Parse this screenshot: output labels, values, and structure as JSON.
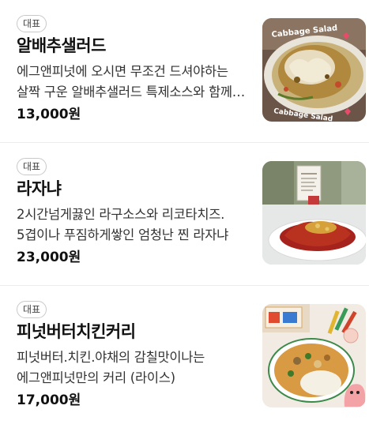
{
  "menu": {
    "items": [
      {
        "badge": "대표",
        "name": "알배추샐러드",
        "description": "에그앤피넛에 오시면 무조건 드셔야하는 살짝 구운 알배추샐러드 특제소스와 함께 즐기는 메뉴",
        "price": "13,000원",
        "image_text": "Cabbage Salad",
        "image_icon": "cabbage-salad-photo"
      },
      {
        "badge": "대표",
        "name": "라자냐",
        "description": "2시간넘게끓인 라구소스와 리코타치즈. 5겹이나 푸짐하게쌓인 엄청난 찐 라자냐",
        "price": "23,000원",
        "image_icon": "lasagna-photo"
      },
      {
        "badge": "대표",
        "name": "피넛버터치킨커리",
        "description": "피넛버터.치킨.야채의 감칠맛이나는 에그앤피넛만의 커리 (라이스)",
        "price": "17,000원",
        "image_icon": "curry-photo"
      }
    ]
  }
}
